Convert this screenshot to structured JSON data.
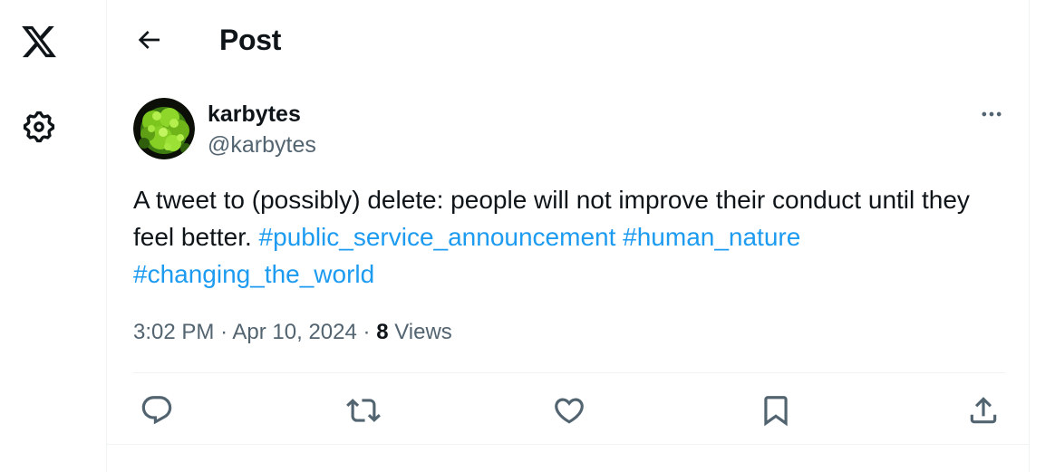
{
  "app": {
    "logo_icon": "x-logo-icon",
    "settings_icon": "gear-icon"
  },
  "header": {
    "title": "Post",
    "back_icon": "arrow-left-icon"
  },
  "post": {
    "author": {
      "name": "karbytes",
      "handle": "@karbytes",
      "avatar": "green-moss-avatar"
    },
    "more_icon": "ellipsis-icon",
    "text": "A tweet to (possibly) delete: people will not improve their conduct until they feel better.",
    "hashtags": [
      "#public_service_announcement",
      "#human_nature",
      "#changing_the_world"
    ],
    "time": "3:02 PM",
    "separator": "·",
    "date": "Apr 10, 2024",
    "views_count": "8",
    "views_label": "Views"
  },
  "actions": [
    {
      "name": "reply",
      "icon": "reply-icon"
    },
    {
      "name": "repost",
      "icon": "repost-icon"
    },
    {
      "name": "like",
      "icon": "heart-icon"
    },
    {
      "name": "bookmark",
      "icon": "bookmark-icon"
    },
    {
      "name": "share",
      "icon": "share-icon"
    }
  ],
  "colors": {
    "text": "#0f1419",
    "secondary": "#536471",
    "link": "#1d9bf0",
    "border": "#eff3f4"
  }
}
